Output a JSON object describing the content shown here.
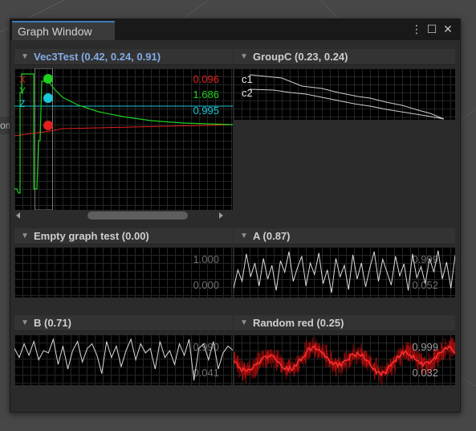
{
  "window": {
    "tab_title": "Graph Window"
  },
  "window_icons": {
    "menu": "⋮",
    "maximize": "☐",
    "close": "✕"
  },
  "background_tab_fragment": "on",
  "graphs": {
    "vec3test": {
      "title": "Vec3Test (0.42, 0.24, 0.91)",
      "series_labels": [
        "X",
        "Y",
        "Z"
      ],
      "values": [
        "0.096",
        "1.686",
        "0.995"
      ],
      "colors": {
        "x": "#e02020",
        "y": "#1fd01f",
        "z": "#1ac8d8"
      }
    },
    "groupc": {
      "title": "GroupC (0.23, 0.24)",
      "series_labels": [
        "c1",
        "c2"
      ]
    },
    "empty": {
      "title": "Empty graph test (0.00)",
      "max": "1.000",
      "min": "0.000"
    },
    "a": {
      "title": "A (0.87)",
      "max": "0.999",
      "min": "0.052",
      "values": [
        0.15,
        0.55,
        0.3,
        0.9,
        0.4,
        0.7,
        0.2,
        0.8,
        0.35,
        0.65,
        0.1,
        0.75,
        0.5,
        0.95,
        0.3,
        0.6,
        0.85,
        0.2,
        0.7,
        0.45,
        0.92,
        0.25,
        0.55,
        0.05,
        0.8,
        0.4,
        0.65,
        0.12,
        0.88,
        0.35,
        0.7,
        0.18,
        0.6,
        0.95,
        0.3,
        0.78,
        0.5,
        0.22,
        0.85,
        0.42,
        0.68,
        0.1,
        0.9,
        0.38,
        0.62,
        0.25,
        0.8,
        0.5,
        0.97,
        0.35,
        0.72,
        0.15,
        0.87
      ]
    },
    "b": {
      "title": "B (0.71)",
      "max": "0.990",
      "min": "0.041",
      "values": [
        0.75,
        0.55,
        0.85,
        0.6,
        0.9,
        0.5,
        0.7,
        0.65,
        0.95,
        0.4,
        0.8,
        0.3,
        0.7,
        0.9,
        0.45,
        0.75,
        0.85,
        0.6,
        0.2,
        0.9,
        0.55,
        0.8,
        0.35,
        0.7,
        0.95,
        0.5,
        0.85,
        0.65,
        0.75,
        0.3,
        0.9,
        0.55,
        0.7,
        0.4,
        0.85,
        0.6,
        0.95,
        0.05,
        0.75,
        0.85,
        0.5,
        0.9,
        0.3,
        0.65,
        0.8,
        0.71
      ]
    },
    "random_red": {
      "title": "Random red (0.25)",
      "max": "0.999",
      "min": "0.032",
      "color": "#d41010"
    }
  }
}
